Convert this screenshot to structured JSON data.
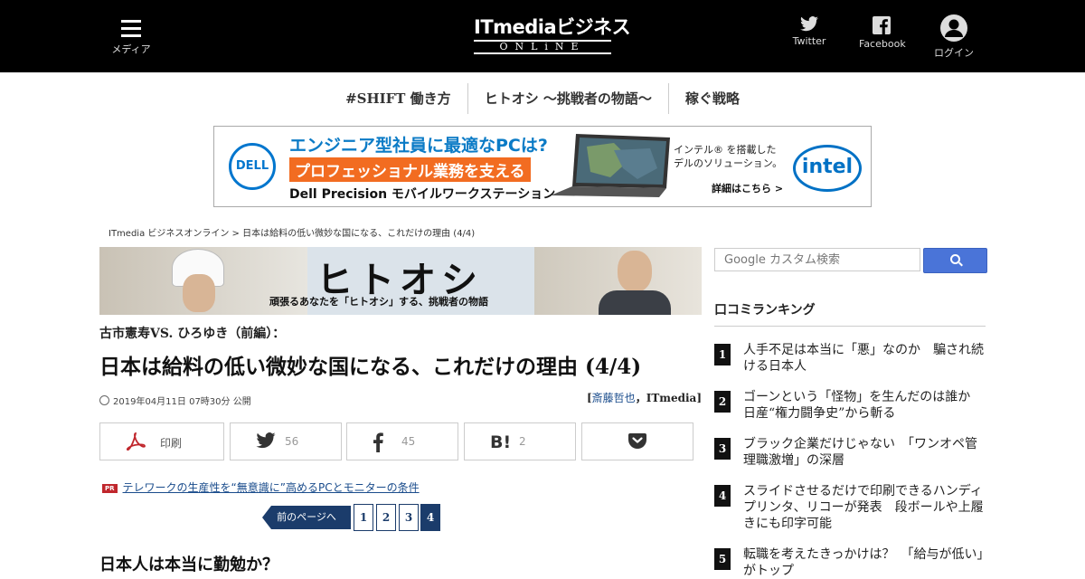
{
  "header": {
    "menu_label": "メディア",
    "logo_line1": "ITmediaビジネス",
    "logo_line2": "ONLiNE",
    "twitter_label": "Twitter",
    "facebook_label": "Facebook",
    "login_label": "ログイン",
    "bg_color": "#000000"
  },
  "nav": {
    "items": [
      {
        "label": "#SHIFT 働き方"
      },
      {
        "label": "ヒトオシ ～挑戦者の物語～"
      },
      {
        "label": "稼ぐ戦略"
      }
    ]
  },
  "ad": {
    "brand": "DELL",
    "headline": "エンジニア型社員に最適なPCは?",
    "highlight": "プロフェッショナル業務を支える",
    "product": "Dell Precision モバイルワークステーション",
    "intel_line1": "インテル® を搭載した",
    "intel_line2": "デルのソリューション。",
    "detail": "詳細はこちら >",
    "intel_logo": "intel",
    "colors": {
      "dell_blue": "#0076ce",
      "orange": "#f26c21",
      "intel_blue": "#0071c5"
    }
  },
  "breadcrumb": "ITmedia ビジネスオンライン > 日本は給料の低い微妙な国になる、これだけの理由 (4/4)",
  "banner": {
    "title": "ヒトオシ",
    "subtitle": "頑張るあなたを「ヒトオシ」する、挑戦者の物語"
  },
  "article": {
    "kicker": "古市憲寿VS. ひろゆき（前編）：",
    "title": "日本は給料の低い微妙な国になる、これだけの理由 (4/4)",
    "date": "2019年04月11日 07時30分 公開",
    "author_open": "[",
    "author_name": "斎藤哲也",
    "author_sep": "，",
    "author_org": "ITmedia",
    "author_close": "]",
    "section_heading": "日本人は本当に勤勉か？"
  },
  "share": {
    "print_label": "印刷",
    "twitter_count": "56",
    "facebook_count": "45",
    "hatena_count": "2"
  },
  "pr": {
    "badge": "PR",
    "link_text": "テレワークの生産性を“無意識に”高めるPCとモニターの条件"
  },
  "pager": {
    "prev_label": "前のページへ",
    "pages": [
      "1",
      "2",
      "3",
      "4"
    ],
    "current": "4",
    "accent": "#1b3c6b"
  },
  "sidebar": {
    "search_placeholder": "Google カスタム検索",
    "ranking_title": "口コミランキング",
    "ranking": [
      {
        "num": "1",
        "title": "人手不足は本当に「悪」なのか　騙され続ける日本人"
      },
      {
        "num": "2",
        "title": "ゴーンという「怪物」を生んだのは誰か　日産“権力闘争史”から斬る"
      },
      {
        "num": "3",
        "title": "ブラック企業だけじゃない　「ワンオペ管理職激増」の深層"
      },
      {
        "num": "4",
        "title": "スライドさせるだけで印刷できるハンディプリンタ、リコーが発表　段ボールや上履きにも印字可能"
      },
      {
        "num": "5",
        "title": "転職を考えたきっかけは？　「給与が低い」がトップ"
      }
    ]
  }
}
